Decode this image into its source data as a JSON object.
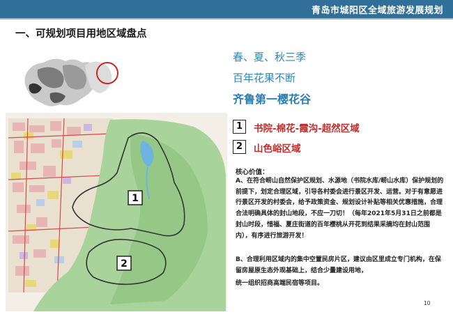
{
  "header": {
    "title": "青岛市城阳区全域旅游发展规划"
  },
  "section": {
    "title": "一、可规划项目用地区域盘点"
  },
  "intro": {
    "line1": "春、夏、秋三季",
    "line2": "百年花果不断",
    "line3": "齐鲁第一樱花谷"
  },
  "areas": [
    {
      "number": "1",
      "label": "书院-棉花-霞沟-超然区域"
    },
    {
      "number": "2",
      "label": "山色峪区域"
    }
  ],
  "core": {
    "title": "核心价值：",
    "para_a": "A、在符合崂山自然保护区规划、水源地（书院水库/崂山水库）保护规划的前提下，划定合理区域，引导各村委会进行景区开发、运营。对于有意愿进行景区开发的村委会，给予政策资金、规划设计补贴等相关优惠措施，合理合法明确具体的封山地段，不应一刀切！（每年2021年5月31日之前都是封山时段，惜福、夏庄街道的百年樱桃从开花到结果采摘均在封山范围内），有序进行旅游开发！",
    "para_b": "B、合理利用区域内的集中空置民房片区，建议由区里成立专门机构，在保留房屋原生态外观基础上，结合少量建设用地，",
    "para_b2": "统一组织招商高端民宿等项目。"
  },
  "map": {
    "label_1": "1",
    "label_2": "2"
  },
  "footer": {
    "page_number": "10"
  },
  "colors": {
    "header": "#2f6f98",
    "accent_blue": "#2f86b4",
    "area_red": "#c22a2a",
    "map_green": "#a8d39a"
  }
}
